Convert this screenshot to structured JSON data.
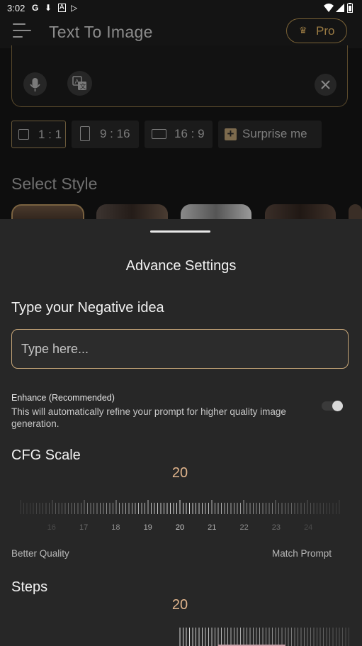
{
  "status_bar": {
    "time": "3:02",
    "icons": [
      "google-icon",
      "download-icon",
      "news-icon",
      "play-store-icon",
      "wifi-icon",
      "signal-icon",
      "battery-icon"
    ]
  },
  "app_bar": {
    "title": "Text To Image",
    "pro_label": "Pro",
    "accent_color": "#9c7c44"
  },
  "prompt": {
    "icons": [
      "mic-icon",
      "translate-icon",
      "clear-icon"
    ]
  },
  "aspect_ratios": [
    {
      "label": "1 : 1",
      "selected": true
    },
    {
      "label": "9 : 16",
      "selected": false
    },
    {
      "label": "16 : 9",
      "selected": false
    },
    {
      "label": "Surprise me",
      "selected": false
    }
  ],
  "select_style": {
    "title": "Select Style"
  },
  "advance_settings": {
    "title": "Advance Settings",
    "negative_label": "Type your Negative idea",
    "negative_placeholder": "Type here...",
    "enhance_title": "Enhance (Recommended)",
    "enhance_description": "This will automatically refine your prompt for higher quality image generation.",
    "enhance_enabled": false,
    "cfg": {
      "label": "CFG Scale",
      "value": "20",
      "scale_labels": [
        "16",
        "17",
        "18",
        "19",
        "20",
        "21",
        "22",
        "23",
        "24"
      ],
      "min_label": "Better Quality",
      "max_label": "Match Prompt"
    },
    "steps": {
      "label": "Steps",
      "value": "20"
    },
    "value_color": "#e0b48c"
  }
}
